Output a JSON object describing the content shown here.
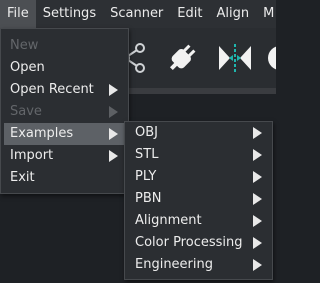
{
  "menubar": {
    "items": [
      "File",
      "Settings",
      "Scanner",
      "Edit",
      "Align",
      "M"
    ]
  },
  "file_menu": {
    "items": [
      {
        "label": "New",
        "enabled": false,
        "submenu": false
      },
      {
        "label": "Open",
        "enabled": true,
        "submenu": false
      },
      {
        "label": "Open Recent",
        "enabled": true,
        "submenu": true
      },
      {
        "label": "Save",
        "enabled": false,
        "submenu": true
      },
      {
        "label": "Examples",
        "enabled": true,
        "submenu": true,
        "highlighted": true
      },
      {
        "label": "Import",
        "enabled": true,
        "submenu": true
      },
      {
        "label": "Exit",
        "enabled": true,
        "submenu": false
      }
    ]
  },
  "examples_menu": {
    "items": [
      {
        "label": "OBJ",
        "submenu": true
      },
      {
        "label": "STL",
        "submenu": true
      },
      {
        "label": "PLY",
        "submenu": true
      },
      {
        "label": "PBN",
        "submenu": true
      },
      {
        "label": "Alignment",
        "submenu": true
      },
      {
        "label": "Color Processing",
        "submenu": true
      },
      {
        "label": "Engineering",
        "submenu": true
      }
    ]
  },
  "toolbar": {
    "icons": [
      "share-icon",
      "plug-icon",
      "align-icon",
      "circle-tool-icon"
    ]
  },
  "colors": {
    "accent": "#1fb5ad",
    "menu_bg": "#2b2e32",
    "highlight": "#5d6166"
  }
}
